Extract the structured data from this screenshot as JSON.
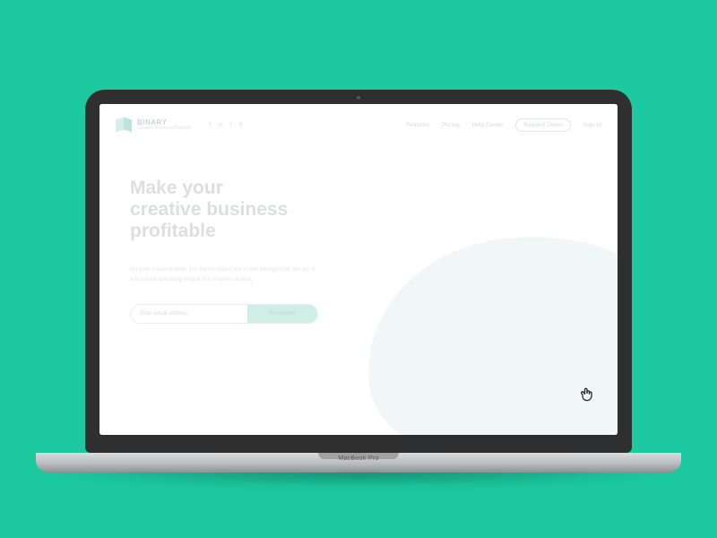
{
  "device": {
    "label": "MacBook Pro"
  },
  "brand": {
    "name": "BINARY",
    "tagline": "Creative Business Platform"
  },
  "socials": [
    "f",
    "in",
    "t",
    "d"
  ],
  "nav": {
    "links": [
      {
        "label": "Features"
      },
      {
        "label": "Pricing"
      },
      {
        "label": "Help Center"
      },
      {
        "label": "Request Demo",
        "pill": true
      },
      {
        "label": "Sign In"
      }
    ]
  },
  "hero": {
    "title_line1": "Make your",
    "title_line2": "creative business",
    "title_line3": "profitable",
    "subtitle": "Do your creative work. Let the business run in the background. Binary is a financial operating engine for creative studios."
  },
  "signup": {
    "placeholder": "Enter email address",
    "button": "Get Started"
  }
}
